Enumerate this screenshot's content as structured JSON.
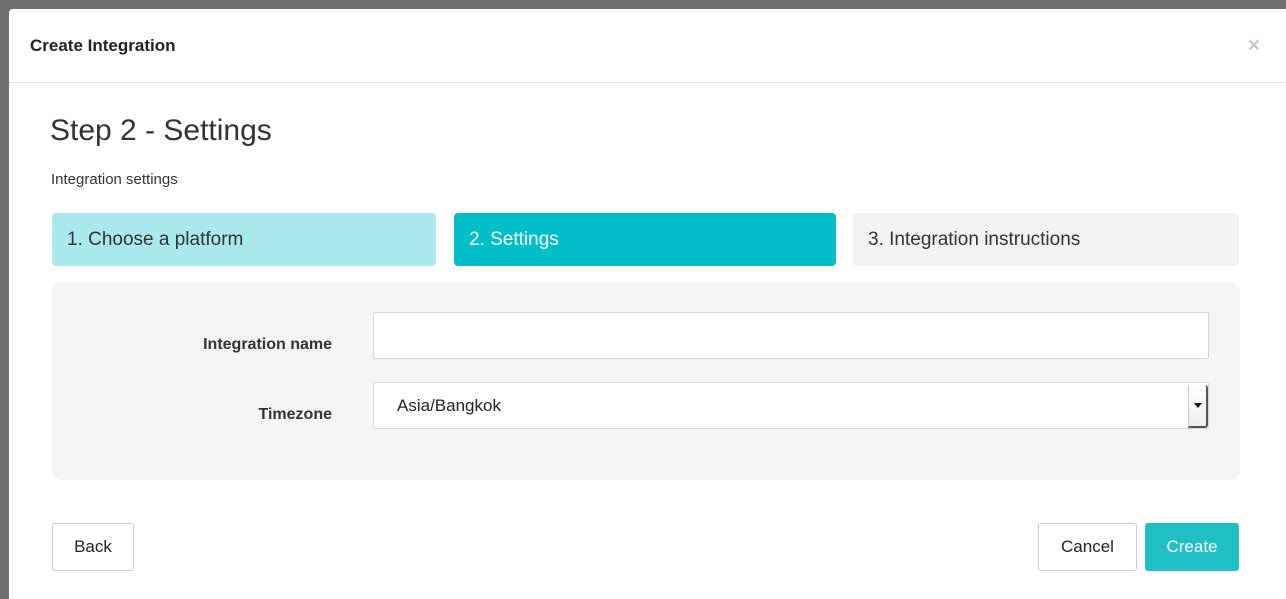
{
  "modal": {
    "title": "Create Integration",
    "close_symbol": "×"
  },
  "step": {
    "title": "Step 2 - Settings",
    "subtitle": "Integration settings"
  },
  "wizard": {
    "steps": [
      {
        "label": "1. Choose a platform",
        "state": "done"
      },
      {
        "label": "2. Settings",
        "state": "active"
      },
      {
        "label": "3. Integration instructions",
        "state": "todo"
      }
    ]
  },
  "form": {
    "integration_name_label": "Integration name",
    "integration_name_value": "",
    "timezone_label": "Timezone",
    "timezone_value": "Asia/Bangkok"
  },
  "footer": {
    "back_label": "Back",
    "cancel_label": "Cancel",
    "create_label": "Create"
  },
  "colors": {
    "accent": "#00bfc8",
    "step_done": "#a9e9ee",
    "step_todo": "#f2f2f2",
    "create_button": "#20bfc4"
  }
}
